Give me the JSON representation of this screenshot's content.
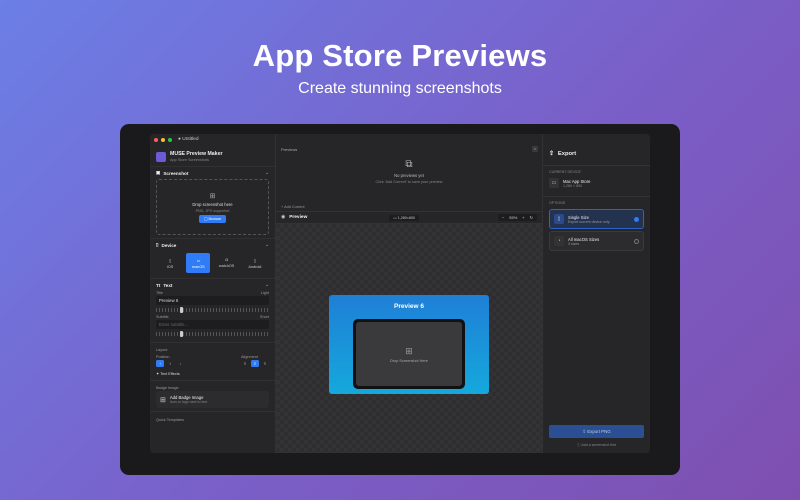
{
  "hero": {
    "title": "App Store Previews",
    "subtitle": "Create stunning screenshots"
  },
  "window": {
    "title": "Untitled"
  },
  "app": {
    "name": "MUSE Preview Maker",
    "subtitle": "App Store Screenshots"
  },
  "sidebar": {
    "screenshot": {
      "header": "Screenshot",
      "drop_title": "Drop screenshot here",
      "drop_sub": "PNG, JPG supported",
      "browse_label": "Browse"
    },
    "device": {
      "header": "Device",
      "options": [
        {
          "label": "iOS",
          "active": false
        },
        {
          "label": "macOS",
          "active": true
        },
        {
          "label": "watchOS",
          "active": false
        },
        {
          "label": "Android",
          "active": false
        }
      ]
    },
    "text": {
      "header": "Text",
      "title_label": "Title",
      "title_weight": "Light",
      "title_value": "Preview 6",
      "subtitle_label": "Subtitle",
      "subtitle_weight": "Short",
      "subtitle_placeholder": "Enter subtitle..."
    },
    "layout": {
      "header": "Layout",
      "position_label": "Position",
      "alignment_label": "Alignment",
      "text_effects_label": "Text Effects"
    },
    "badge": {
      "header": "Badge Image",
      "title": "Add Badge Image",
      "sub": "Icon or logo next to text"
    },
    "quick_templates_label": "Quick Templates"
  },
  "previews": {
    "title": "Previews",
    "empty_title": "No previews yet",
    "empty_sub": "Click 'Add Current' to save your preview",
    "add_current_label": "Add Current"
  },
  "toolbar": {
    "title": "Preview",
    "size": "1,280×800",
    "zoom": "55%"
  },
  "canvas": {
    "card_title": "Preview 6",
    "drop_text": "Drop Screenshot Here"
  },
  "export": {
    "header": "Export",
    "current_device_label": "CURRENT DEVICE",
    "device_name": "Mac App Store",
    "device_size": "1,280 × 800",
    "options_label": "OPTIONS",
    "options": [
      {
        "title": "Single Size",
        "sub": "Export current device only",
        "selected": true
      },
      {
        "title": "All macOS Sizes",
        "sub": "3 sizes",
        "selected": false
      }
    ],
    "button_label": "Export PNG",
    "hint": "Add a screenshot first"
  },
  "colors": {
    "accent": "#2f7cf6",
    "card_gradient_top": "#1f7fd6",
    "card_gradient_bottom": "#15a8dc"
  }
}
